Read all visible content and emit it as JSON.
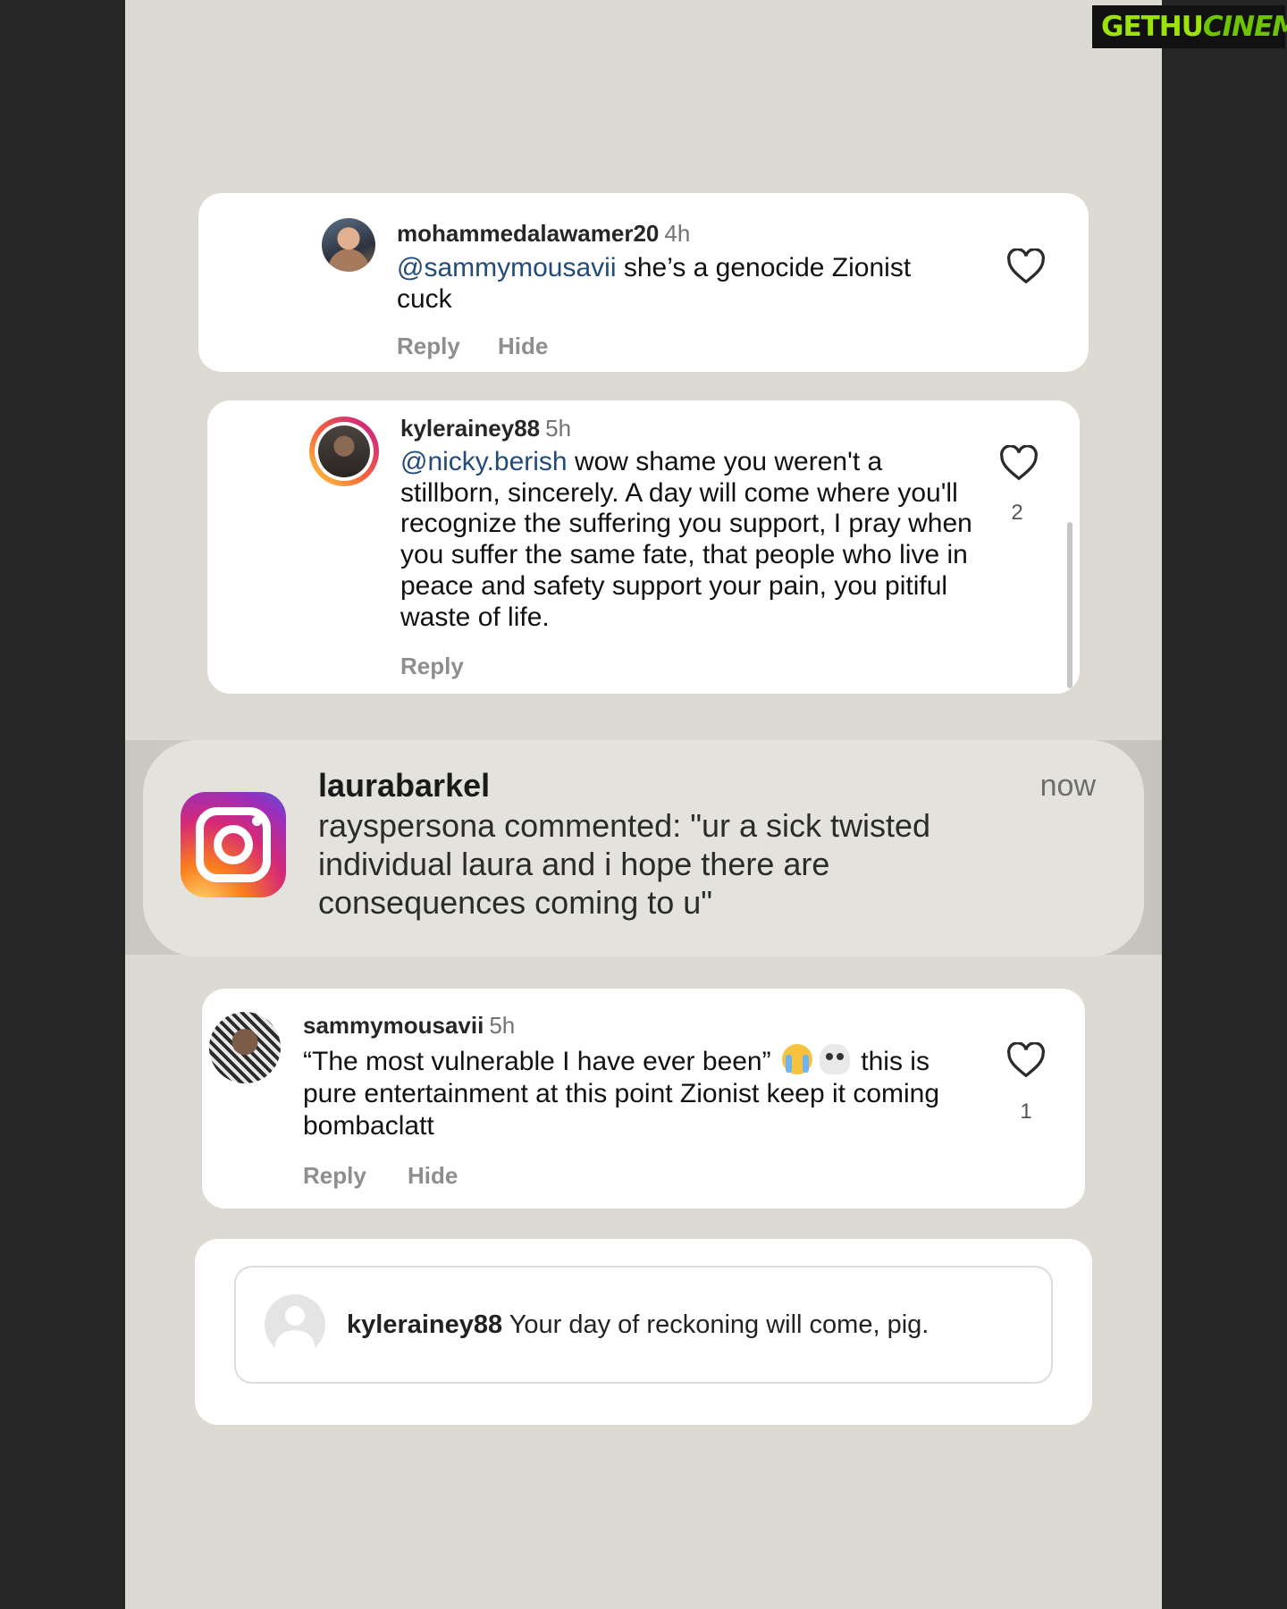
{
  "watermark": {
    "part1": "GETHU",
    "part2": "CINEMA"
  },
  "comments": [
    {
      "username": "mohammedalawamer20",
      "time": "4h",
      "mention": "@sammymousavii",
      "text": " she’s a genocide Zionist cuck",
      "actions": {
        "reply": "Reply",
        "hide": "Hide"
      }
    },
    {
      "username": "kylerainey88",
      "time": "5h",
      "mention": "@nicky.berish",
      "text": " wow shame you weren't a stillborn, sincerely. A day will come where you'll recognize the suffering you support, I pray when you suffer the same fate, that people who live in peace and safety support your pain, you pitiful waste of life.",
      "likes": "2",
      "actions": {
        "reply": "Reply"
      }
    },
    {
      "username": "sammymousavii",
      "time": "5h",
      "text_part1": "“The most vulnerable I have ever been”",
      "emoji_names": [
        "loudly-crying-face-emoji",
        "skull-emoji"
      ],
      "text_part2": " this is pure entertainment at this point Zionist keep it coming bombaclatt",
      "likes": "1",
      "actions": {
        "reply": "Reply",
        "hide": "Hide"
      }
    }
  ],
  "notification": {
    "app_icon": "instagram-logo-icon",
    "title": "laurabarkel",
    "time": "now",
    "body": "rayspersona commented: \"ur a sick twisted individual laura and i hope there are consequences coming to u\""
  },
  "reply_preview": {
    "username": "kylerainey88",
    "text": "Your day of reckoning will come, pig."
  },
  "colors": {
    "background": "#dddad3",
    "mention": "#224b7a",
    "muted": "#8e8e8e",
    "story_ring_start": "#fdd23c",
    "story_ring_end": "#c1178f"
  }
}
